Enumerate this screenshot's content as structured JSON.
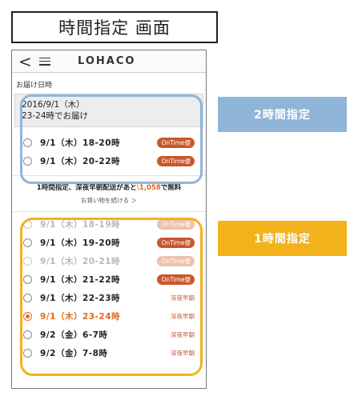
{
  "header_title": "時間指定 画面",
  "nav": {
    "back_glyph": "<",
    "logo": "LOHACO"
  },
  "delivery": {
    "label": "お届け日時",
    "selected_date_line1": "2016/9/1（木）",
    "selected_date_line2": "23-24時でお届け"
  },
  "slots_2h": [
    {
      "label": "9/1（木）18-20時",
      "badge": "OnTime便"
    },
    {
      "label": "9/1（木）20-22時",
      "badge": "OnTime便"
    }
  ],
  "promo": {
    "text_before": "1時間指定、深夜早朝配送があと",
    "amount": "\\1,058",
    "text_after": "で無料",
    "link": "お買い物を続ける ＞"
  },
  "slots_1h": [
    {
      "label": "9/1（木）18-19時",
      "badge": "OnTime便",
      "state": "disabled"
    },
    {
      "label": "9/1（木）19-20時",
      "badge": "OnTime便",
      "state": "normal"
    },
    {
      "label": "9/1（木）20-21時",
      "badge": "OnTime便",
      "state": "disabled"
    },
    {
      "label": "9/1（木）21-22時",
      "badge": "OnTime便",
      "state": "normal"
    },
    {
      "label": "9/1（木）22-23時",
      "note": "深夜早朝",
      "state": "normal"
    },
    {
      "label": "9/1（木）23-24時",
      "note": "深夜早朝",
      "state": "selected"
    },
    {
      "label": "9/2（金）6-7時",
      "note": "深夜早朝",
      "state": "normal"
    },
    {
      "label": "9/2（金）7-8時",
      "note": "深夜早朝",
      "state": "normal"
    }
  ],
  "annotations": {
    "two_hour": "2時間指定",
    "one_hour": "1時間指定"
  },
  "colors": {
    "accent_orange": "#e06a1c",
    "badge": "#c9572c",
    "highlight_blue": "#8fb6d9",
    "highlight_orange": "#f3b21b"
  }
}
